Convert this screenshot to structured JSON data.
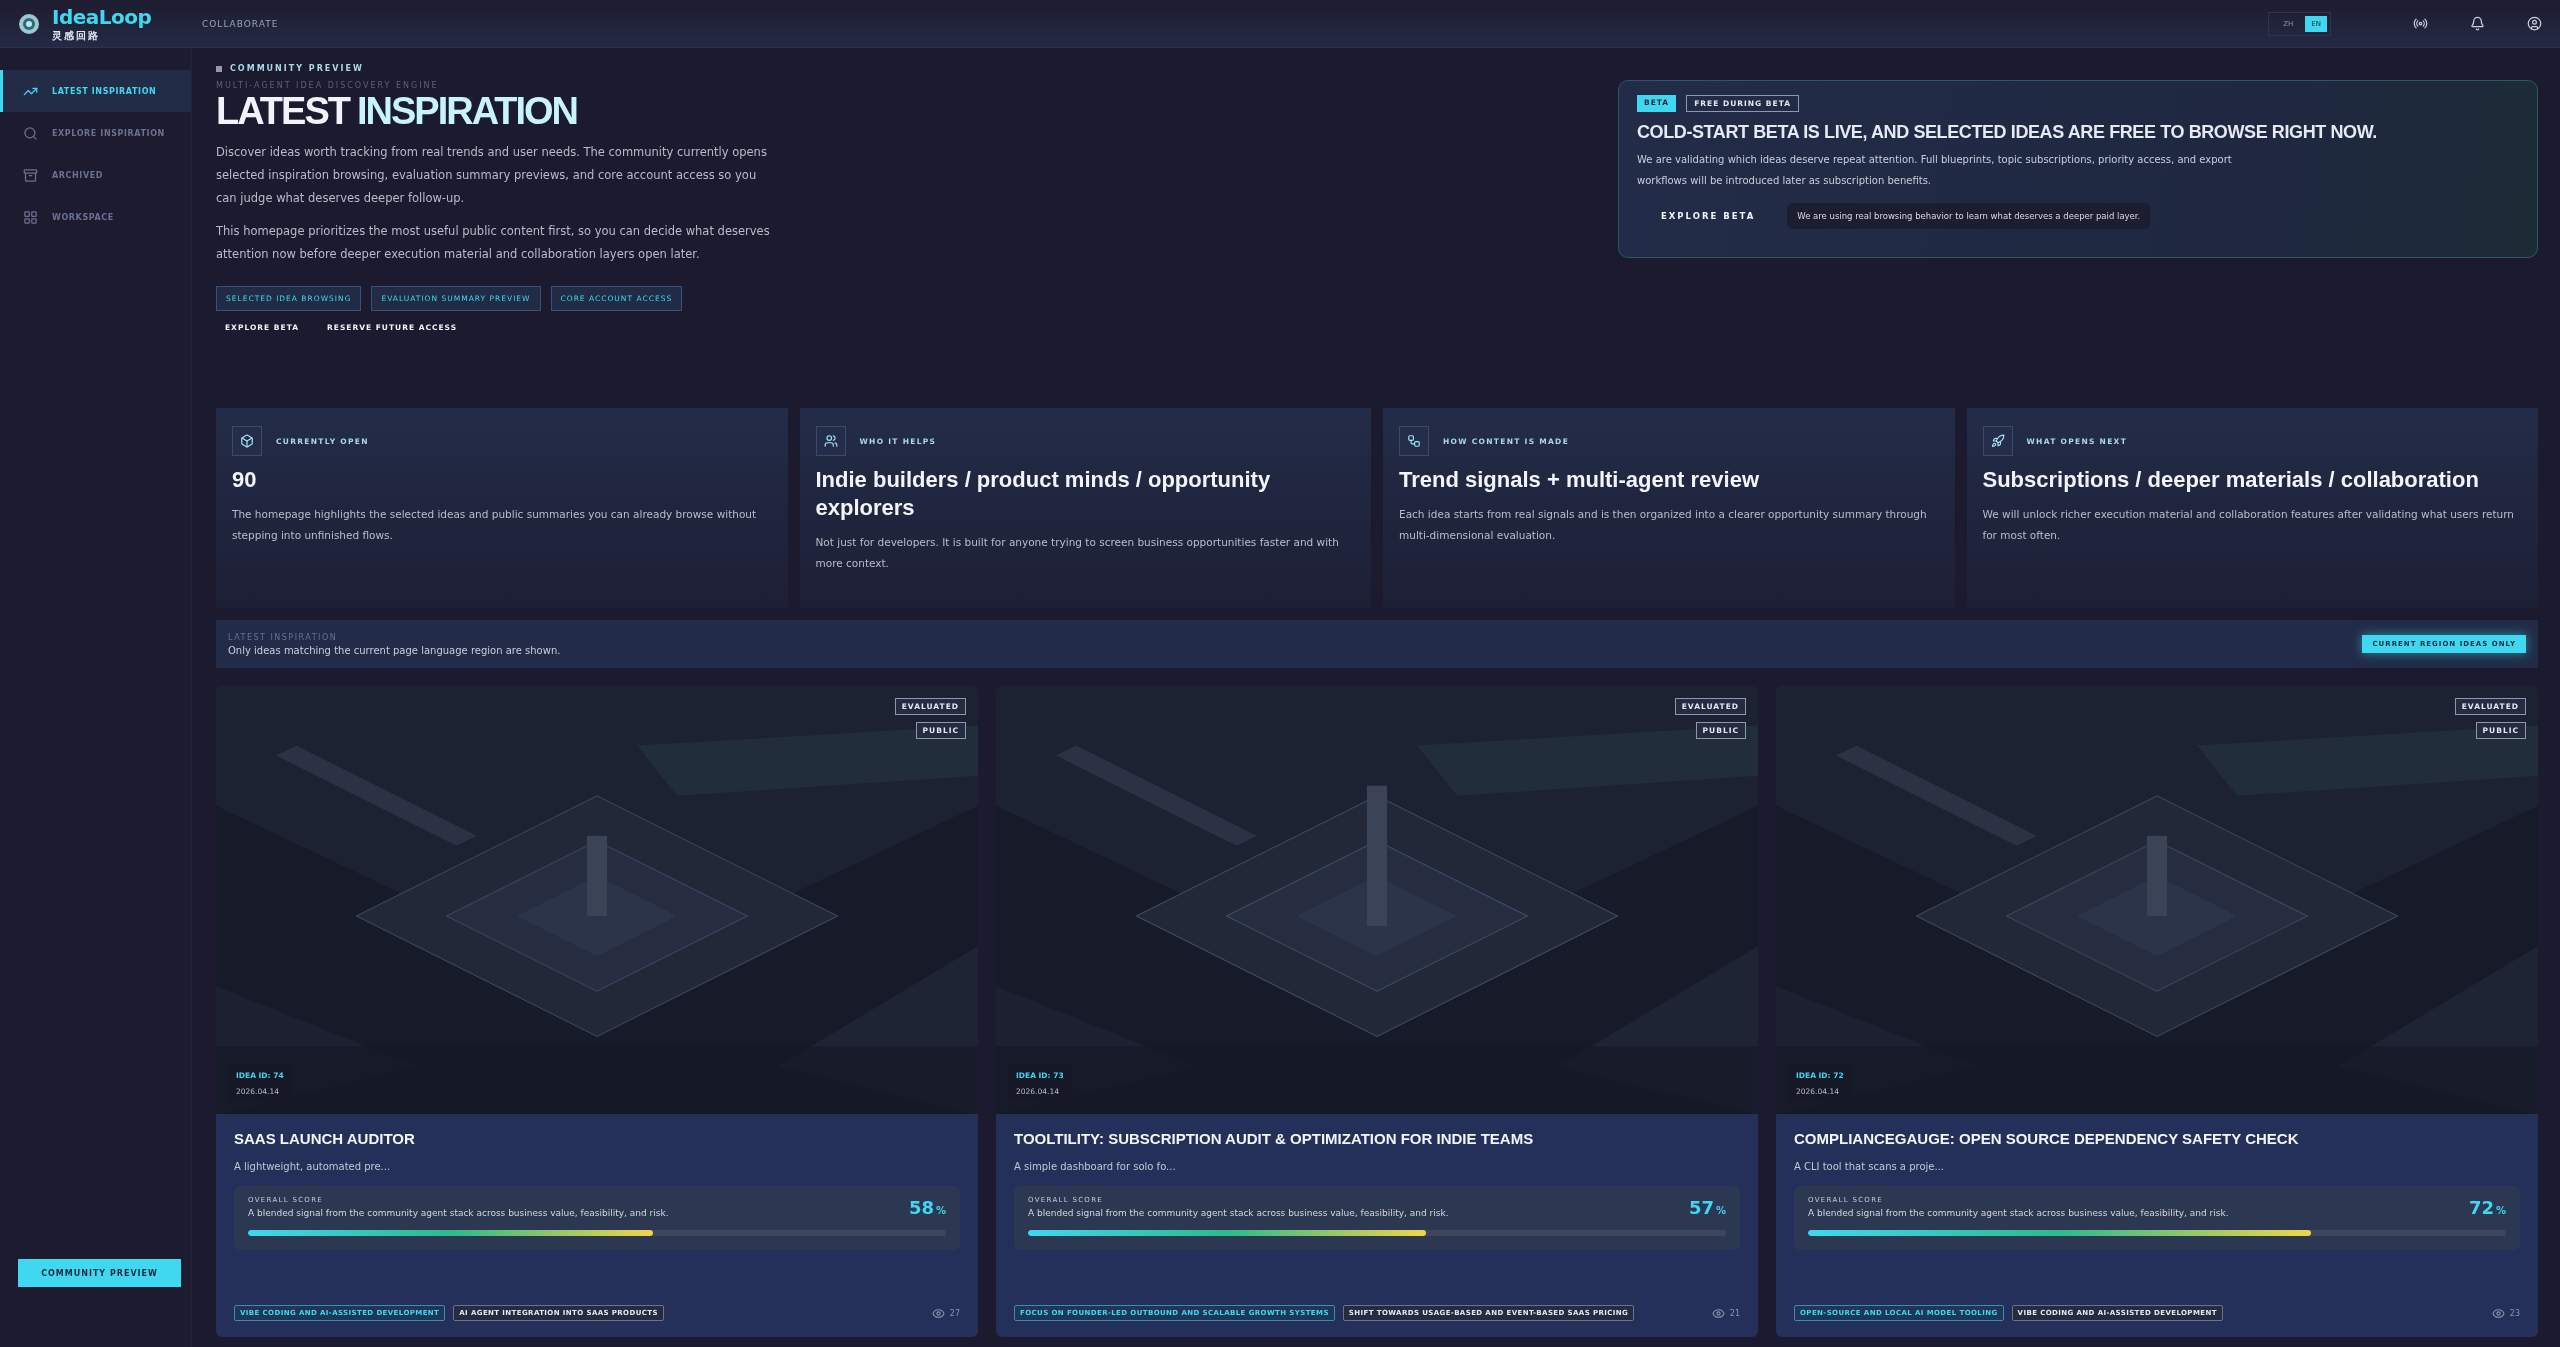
{
  "header": {
    "brand": "IdeaLoop",
    "brand_sub": "灵感回路",
    "nav": [
      "COLLABORATE"
    ],
    "languages": [
      {
        "label": "ZH",
        "selected": false
      },
      {
        "label": "EN",
        "selected": true
      }
    ]
  },
  "sidebar": {
    "items": [
      {
        "label": "LATEST INSPIRATION",
        "selected": true
      },
      {
        "label": "EXPLORE INSPIRATION",
        "selected": false
      },
      {
        "label": "ARCHIVED",
        "selected": false
      },
      {
        "label": "WORKSPACE",
        "selected": false
      }
    ],
    "footer_button": "COMMUNITY PREVIEW"
  },
  "hero": {
    "eyebrow": "COMMUNITY PREVIEW",
    "ghost": "MULTI-AGENT IDEA DISCOVERY ENGINE",
    "title_a": "LATEST",
    "title_b": "INSPIRATION",
    "paragraphs": [
      "Discover ideas worth tracking from real trends and user needs. The community currently opens selected inspiration browsing, evaluation summary previews, and core account access so you can judge what deserves deeper follow-up.",
      "This homepage prioritizes the most useful public content first, so you can decide what deserves attention now before deeper execution material and collaboration layers open later."
    ],
    "chips": [
      "SELECTED IDEA BROWSING",
      "EVALUATION SUMMARY PREVIEW",
      "CORE ACCOUNT ACCESS"
    ],
    "links": [
      "EXPLORE BETA",
      "RESERVE FUTURE ACCESS"
    ]
  },
  "beta": {
    "badges": [
      "BETA",
      "FREE DURING BETA"
    ],
    "title": "COLD-START BETA IS LIVE, AND SELECTED IDEAS ARE FREE TO BROWSE RIGHT NOW.",
    "text": "We are validating which ideas deserve repeat attention. Full blueprints, topic subscriptions, priority access, and export workflows will be introduced later as subscription benefits.",
    "button": "EXPLORE BETA",
    "tooltip": "We are using real browsing behavior to learn what deserves a deeper paid layer."
  },
  "info_cards": [
    {
      "label": "CURRENTLY OPEN",
      "value": "90",
      "text": "The homepage highlights the selected ideas and public summaries you can already browse without stepping into unfinished flows."
    },
    {
      "label": "WHO IT HELPS",
      "value": "Indie builders / product minds / opportunity explorers",
      "text": "Not just for developers. It is built for anyone trying to screen business opportunities faster and with more context."
    },
    {
      "label": "HOW CONTENT IS MADE",
      "value": "Trend signals + multi-agent review",
      "text": "Each idea starts from real signals and is then organized into a clearer opportunity summary through multi-dimensional evaluation."
    },
    {
      "label": "WHAT OPENS NEXT",
      "value": "Subscriptions / deeper materials / collaboration",
      "text": "We will unlock richer execution material and collaboration features after validating what users return for most often."
    }
  ],
  "region_bar": {
    "ghost": "LATEST INSPIRATION",
    "text": "Only ideas matching the current page language region are shown.",
    "button": "CURRENT REGION IDEAS ONLY"
  },
  "ideas": [
    {
      "badges": [
        "EVALUATED",
        "PUBLIC"
      ],
      "idea_id": "IDEA ID: 74",
      "date": "2026.04.14",
      "title": "SAAS LAUNCH AUDITOR",
      "summary": "A lightweight, automated pre...",
      "score_label": "OVERALL SCORE",
      "score_text": "A blended signal from the community agent stack across business value, feasibility, and risk.",
      "score": "58",
      "unit": "%",
      "level": 0.58,
      "tags": [
        "VIBE CODING AND AI-ASSISTED DEVELOPMENT",
        "AI AGENT INTEGRATION INTO SAAS PRODUCTS"
      ],
      "views": "27"
    },
    {
      "badges": [
        "EVALUATED",
        "PUBLIC"
      ],
      "idea_id": "IDEA ID: 73",
      "date": "2026.04.14",
      "title": "TOOLTILITY: SUBSCRIPTION AUDIT & OPTIMIZATION FOR INDIE TEAMS",
      "summary": "A simple dashboard for solo fo...",
      "score_label": "OVERALL SCORE",
      "score_text": "A blended signal from the community agent stack across business value, feasibility, and risk.",
      "score": "57",
      "unit": "%",
      "level": 0.57,
      "tags": [
        "FOCUS ON FOUNDER-LED OUTBOUND AND SCALABLE GROWTH SYSTEMS",
        "SHIFT TOWARDS USAGE-BASED AND EVENT-BASED SAAS PRICING"
      ],
      "views": "21"
    },
    {
      "badges": [
        "EVALUATED",
        "PUBLIC"
      ],
      "idea_id": "IDEA ID: 72",
      "date": "2026.04.14",
      "title": "COMPLIANCEGAUGE: OPEN SOURCE DEPENDENCY SAFETY CHECK",
      "summary": "A CLI tool that scans a proje...",
      "score_label": "OVERALL SCORE",
      "score_text": "A blended signal from the community agent stack across business value, feasibility, and risk.",
      "score": "72",
      "unit": "%",
      "level": 0.72,
      "tags": [
        "OPEN-SOURCE AND LOCAL AI MODEL TOOLING",
        "VIBE CODING AND AI-ASSISTED DEVELOPMENT"
      ],
      "views": "23"
    }
  ]
}
